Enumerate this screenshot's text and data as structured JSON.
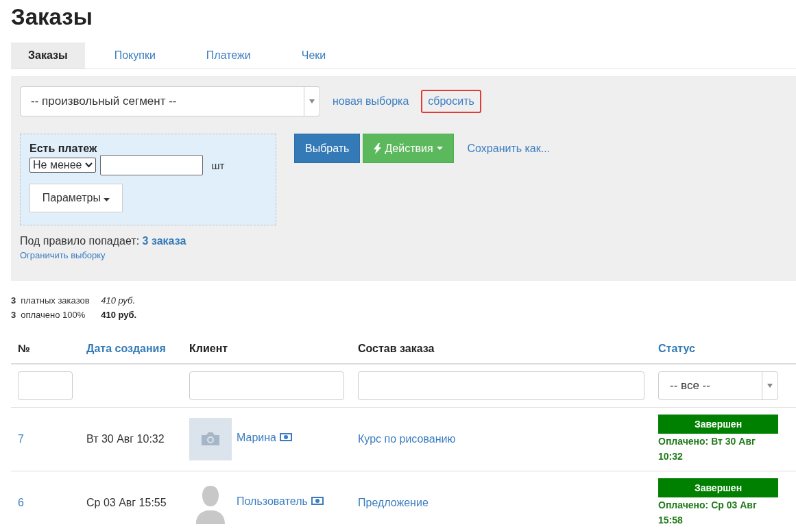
{
  "title": "Заказы",
  "tabs": [
    {
      "label": "Заказы",
      "selected": true
    },
    {
      "label": "Покупки",
      "selected": false
    },
    {
      "label": "Платежи",
      "selected": false
    },
    {
      "label": "Чеки",
      "selected": false
    }
  ],
  "filter": {
    "segment": "-- произвольный сегмент --",
    "links": [
      {
        "label": "новая выборка",
        "highlighted": false
      },
      {
        "label": "сбросить",
        "highlighted": true
      }
    ],
    "condition": {
      "title": "Есть платеж",
      "operator": "Не менее",
      "unit": "шт",
      "params_button": "Параметры"
    },
    "select_button": "Выбрать",
    "actions_button": "Действия",
    "save_link": "Сохранить как...",
    "match_label": "Под правило попадает:",
    "match_count": "3 заказа",
    "limit_link": "Ограничить выборку"
  },
  "summary": [
    {
      "count": "3",
      "label": "платных заказов",
      "amount": "410 руб.",
      "kind": "paid"
    },
    {
      "count": "3",
      "label": "оплачено 100%",
      "amount": "410 руб.",
      "kind": "settled"
    }
  ],
  "table": {
    "columns": [
      {
        "label": "№",
        "sortable": false
      },
      {
        "label": "Дата создания",
        "sortable": true
      },
      {
        "label": "Клиент",
        "sortable": false
      },
      {
        "label": "Состав заказа",
        "sortable": false
      },
      {
        "label": "Статус",
        "sortable": true
      }
    ],
    "status_filter": "-- все --",
    "rows": [
      {
        "number": "7",
        "date": "Вт 30 Авг 10:32",
        "avatar": {
          "kind": "photo"
        },
        "client": "Марина",
        "order": "Курс по рисованию",
        "status": "Завершен",
        "paid": "Оплачено: Вт 30 Авг 10:32"
      },
      {
        "number": "6",
        "date": "Ср 03 Авг 15:55",
        "avatar": {
          "kind": "silhouette"
        },
        "client": "Пользователь",
        "order": "Предложение",
        "status": "Завершен",
        "paid": "Оплачено: Ср 03 Авг 15:58"
      }
    ]
  }
}
